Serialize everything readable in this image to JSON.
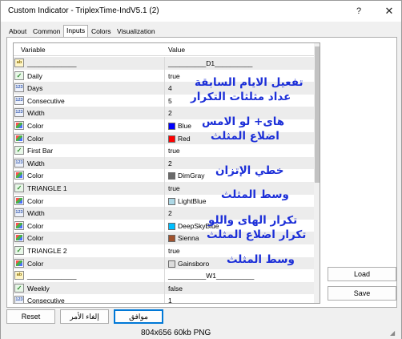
{
  "window": {
    "title": "Custom Indicator - TriplexTime-IndV5.1 (2)",
    "help": "?",
    "close": "✕"
  },
  "tabs": [
    {
      "label": "About"
    },
    {
      "label": "Common"
    },
    {
      "label": "Inputs",
      "active": true
    },
    {
      "label": "Colors"
    },
    {
      "label": "Visualization"
    }
  ],
  "grid": {
    "col_variable": "Variable",
    "col_value": "Value",
    "rows": [
      {
        "icon": "ab",
        "name": "_____________",
        "value": "__________D1__________"
      },
      {
        "icon": "bool",
        "name": "Daily",
        "value": "true"
      },
      {
        "icon": "num",
        "name": "Days",
        "value": "4"
      },
      {
        "icon": "num",
        "name": "Consecutive",
        "value": "5"
      },
      {
        "icon": "num",
        "name": "Width",
        "value": "2"
      },
      {
        "icon": "color",
        "name": "Color",
        "value": "Blue",
        "swatch": "#0000ff"
      },
      {
        "icon": "color",
        "name": "Color",
        "value": "Red",
        "swatch": "#ff0000"
      },
      {
        "icon": "bool",
        "name": "First Bar",
        "value": "true"
      },
      {
        "icon": "num",
        "name": "Width",
        "value": "2"
      },
      {
        "icon": "color",
        "name": "Color",
        "value": "DimGray",
        "swatch": "#696969"
      },
      {
        "icon": "bool",
        "name": "TRIANGLE 1",
        "value": "true"
      },
      {
        "icon": "color",
        "name": "Color",
        "value": "LightBlue",
        "swatch": "#add8e6"
      },
      {
        "icon": "num",
        "name": "Width",
        "value": "2"
      },
      {
        "icon": "color",
        "name": "Color",
        "value": "DeepSkyBlue",
        "swatch": "#00bfff"
      },
      {
        "icon": "color",
        "name": "Color",
        "value": "Sienna",
        "swatch": "#a0522d"
      },
      {
        "icon": "bool",
        "name": "TRIANGLE 2",
        "value": "true"
      },
      {
        "icon": "color",
        "name": "Color",
        "value": "Gainsboro",
        "swatch": "#dcdcdc"
      },
      {
        "icon": "ab",
        "name": "_____________",
        "value": "__________W1__________"
      },
      {
        "icon": "bool",
        "name": "Weekly",
        "value": "false"
      },
      {
        "icon": "num",
        "name": "Consecutive",
        "value": "1"
      }
    ]
  },
  "notes": [
    "تفعيل الايام السابقة",
    "عداد مثلثات التكرار",
    "هاى+ لو الامس",
    "اضلاع المثلث",
    "خطي الإتزان",
    "وسط المثلث",
    "تكرار الهاى واللو",
    "تكرار اضلاع المثلث",
    "وسط المثلث"
  ],
  "side_buttons": {
    "load": "Load",
    "save": "Save"
  },
  "bottom_buttons": {
    "reset": "Reset",
    "cancel": "إلغاء الأمر",
    "ok": "موافق"
  },
  "status": {
    "text": "804x656  60kb  PNG"
  }
}
